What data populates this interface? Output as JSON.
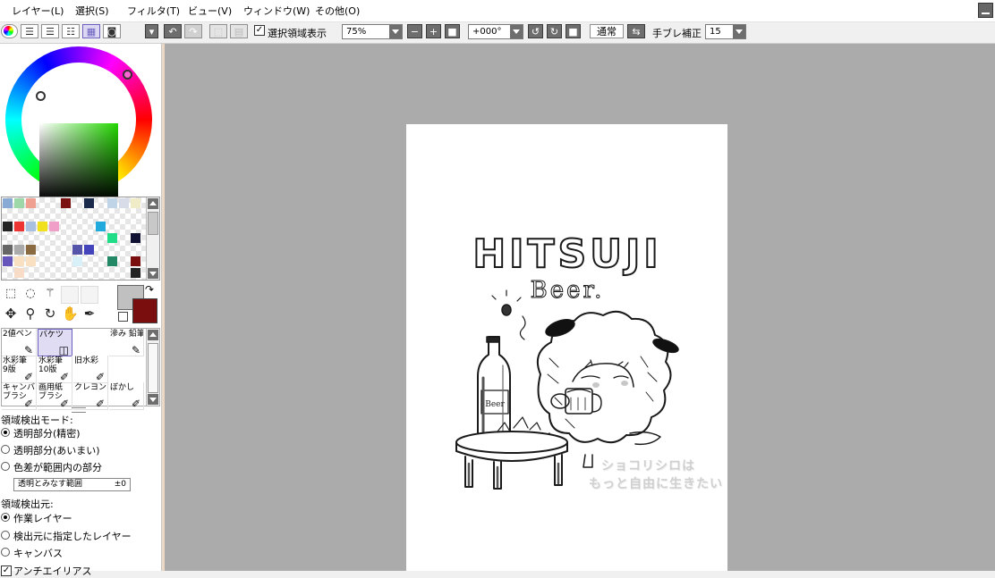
{
  "menu": [
    "レイヤー(L)",
    "選択(S)",
    "フィルタ(T)",
    "ビュー(V)",
    "ウィンドウ(W)",
    "その他(O)"
  ],
  "toolbar": {
    "selection_display_label": "選択領域表示",
    "selection_display_checked": true,
    "zoom": "75%",
    "rotation": "+000°",
    "blend_mode": "通常",
    "stabilizer_label": "手ブレ補正",
    "stabilizer_value": "15"
  },
  "palette": {
    "swatches": [
      {
        "r": 0,
        "c": 0,
        "color": "#8aaad6"
      },
      {
        "r": 0,
        "c": 1,
        "color": "#9ed8a8"
      },
      {
        "r": 0,
        "c": 2,
        "color": "#f0a090"
      },
      {
        "r": 0,
        "c": 5,
        "color": "#7a1010"
      },
      {
        "r": 0,
        "c": 7,
        "color": "#1a2a4a"
      },
      {
        "r": 0,
        "c": 9,
        "color": "#c0d4e8"
      },
      {
        "r": 0,
        "c": 10,
        "color": "#d8dce8"
      },
      {
        "r": 0,
        "c": 11,
        "color": "#f0ecc8"
      },
      {
        "r": 2,
        "c": 0,
        "color": "#222222"
      },
      {
        "r": 2,
        "c": 1,
        "color": "#ee3333"
      },
      {
        "r": 2,
        "c": 2,
        "color": "#aac0e0"
      },
      {
        "r": 2,
        "c": 3,
        "color": "#f0e020"
      },
      {
        "r": 2,
        "c": 4,
        "color": "#f0a0c8"
      },
      {
        "r": 2,
        "c": 8,
        "color": "#22aadd"
      },
      {
        "r": 3,
        "c": 9,
        "color": "#22dd88"
      },
      {
        "r": 3,
        "c": 11,
        "color": "#111133"
      },
      {
        "r": 4,
        "c": 0,
        "color": "#666666"
      },
      {
        "r": 4,
        "c": 1,
        "color": "#aaaaaa"
      },
      {
        "r": 4,
        "c": 2,
        "color": "#8a6a40"
      },
      {
        "r": 4,
        "c": 6,
        "color": "#5555aa"
      },
      {
        "r": 4,
        "c": 7,
        "color": "#4444bb"
      },
      {
        "r": 5,
        "c": 0,
        "color": "#6655bb"
      },
      {
        "r": 5,
        "c": 1,
        "color": "#f8e0c0"
      },
      {
        "r": 5,
        "c": 2,
        "color": "#f8e0c0"
      },
      {
        "r": 5,
        "c": 6,
        "color": "#d8f0f8"
      },
      {
        "r": 5,
        "c": 9,
        "color": "#228866"
      },
      {
        "r": 5,
        "c": 11,
        "color": "#7a0e0e"
      },
      {
        "r": 6,
        "c": 1,
        "color": "#f8dcc8"
      },
      {
        "r": 6,
        "c": 11,
        "color": "#222222"
      }
    ]
  },
  "colors": {
    "main": "#c0c0c0",
    "sub": "#7a0e0e"
  },
  "brushes": [
    {
      "name": "2値ペン",
      "icon": "✎",
      "col": 0,
      "row": 0,
      "active": false
    },
    {
      "name": "バケツ",
      "icon": "◫",
      "col": 1,
      "row": 0,
      "active": true
    },
    {
      "name": "滲み 鉛筆",
      "icon": "✎",
      "col": 3,
      "row": 0,
      "active": false
    },
    {
      "name": "水彩筆\n9版",
      "icon": "✐",
      "col": 0,
      "row": 1,
      "active": false
    },
    {
      "name": "水彩筆\n10版",
      "icon": "✐",
      "col": 1,
      "row": 1,
      "active": false
    },
    {
      "name": "旧水彩",
      "icon": "✐",
      "col": 2,
      "row": 1,
      "active": false
    },
    {
      "name": "キャンバス\nブラシ",
      "icon": "✐",
      "col": 0,
      "row": 2,
      "active": false
    },
    {
      "name": "画用紙\nブラシ",
      "icon": "✐",
      "col": 1,
      "row": 2,
      "active": false
    },
    {
      "name": "クレヨン",
      "icon": "✐",
      "col": 2,
      "row": 2,
      "active": false
    },
    {
      "name": "ぼかし",
      "icon": "✐",
      "col": 3,
      "row": 2,
      "active": false
    }
  ],
  "options": {
    "detect_mode_label": "領域検出モード:",
    "detect_modes": [
      {
        "label": "透明部分(精密)",
        "selected": true
      },
      {
        "label": "透明部分(あいまい)",
        "selected": false
      },
      {
        "label": "色差が範囲内の部分",
        "selected": false
      }
    ],
    "range_label": "透明とみなす範囲",
    "range_value": "±0",
    "source_label": "領域検出元:",
    "sources": [
      {
        "label": "作業レイヤー",
        "selected": true
      },
      {
        "label": "検出元に指定したレイヤー",
        "selected": false
      },
      {
        "label": "キャンバス",
        "selected": false
      }
    ],
    "antialias_label": "アンチエイリアス"
  },
  "artwork": {
    "title": "HITSUJI",
    "subtitle": "Beer.",
    "bottle_label": "Beer",
    "watermark_line1": "ショコリシロは",
    "watermark_line2": "もっと自由に生きたい"
  }
}
